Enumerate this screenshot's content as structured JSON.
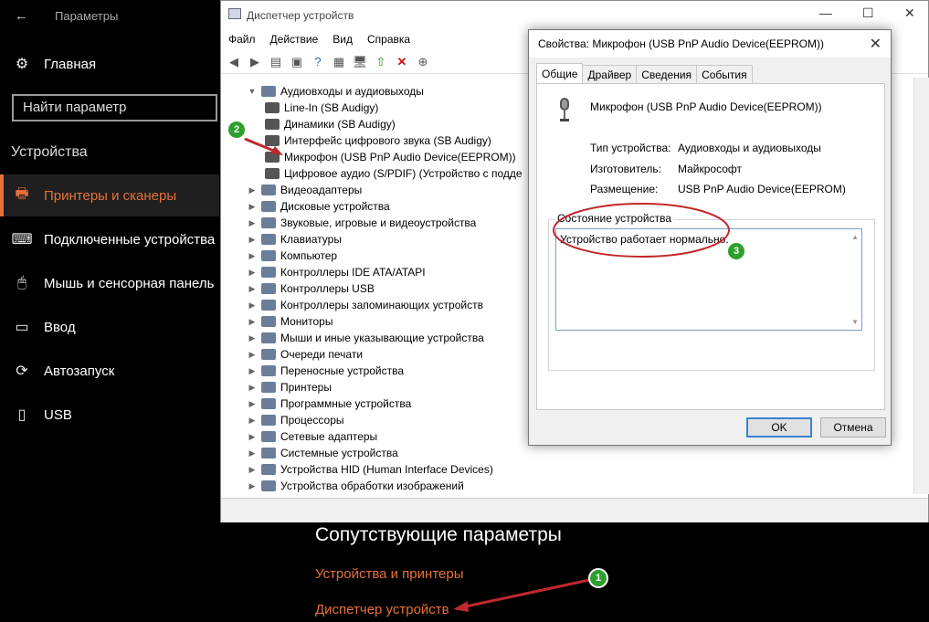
{
  "settings": {
    "title": "Параметры",
    "home": "Главная",
    "search_placeholder": "Найти параметр",
    "section": "Устройства",
    "nav": [
      {
        "label": "Принтеры и сканеры",
        "icon": "printer-icon",
        "glyph": "🖶",
        "active": true
      },
      {
        "label": "Подключенные устройства",
        "icon": "devices-icon",
        "glyph": "⌨"
      },
      {
        "label": "Мышь и сенсорная панель",
        "icon": "mouse-icon",
        "glyph": "🖱"
      },
      {
        "label": "Ввод",
        "icon": "keyboard-icon",
        "glyph": "▭"
      },
      {
        "label": "Автозапуск",
        "icon": "autoplay-icon",
        "glyph": "⟳"
      },
      {
        "label": "USB",
        "icon": "usb-icon",
        "glyph": "▯"
      }
    ],
    "related_title": "Сопутствующие параметры",
    "related_links": [
      "Устройства и принтеры",
      "Диспетчер устройств"
    ],
    "accent": "#e8703a"
  },
  "device_manager": {
    "title": "Диспетчер устройств",
    "menu": [
      "Файл",
      "Действие",
      "Вид",
      "Справка"
    ],
    "tree": [
      {
        "label": "Аудиовходы и аудиовыходы",
        "expanded": true
      },
      {
        "label": "Line-In (SB Audigy)",
        "child": true
      },
      {
        "label": "Динамики (SB Audigy)",
        "child": true
      },
      {
        "label": "Интерфейс цифрового звука (SB Audigy)",
        "child": true
      },
      {
        "label": "Микрофон (USB PnP Audio Device(EEPROM))",
        "child": true
      },
      {
        "label": "Цифровое аудио (S/PDIF) (Устройство с подде",
        "child": true
      },
      {
        "label": "Видеоадаптеры"
      },
      {
        "label": "Дисковые устройства"
      },
      {
        "label": "Звуковые, игровые и видеоустройства"
      },
      {
        "label": "Клавиатуры"
      },
      {
        "label": "Компьютер"
      },
      {
        "label": "Контроллеры IDE ATA/ATAPI"
      },
      {
        "label": "Контроллеры USB"
      },
      {
        "label": "Контроллеры запоминающих устройств"
      },
      {
        "label": "Мониторы"
      },
      {
        "label": "Мыши и иные указывающие устройства"
      },
      {
        "label": "Очереди печати"
      },
      {
        "label": "Переносные устройства"
      },
      {
        "label": "Принтеры"
      },
      {
        "label": "Программные устройства"
      },
      {
        "label": "Процессоры"
      },
      {
        "label": "Сетевые адаптеры"
      },
      {
        "label": "Системные устройства"
      },
      {
        "label": "Устройства HID (Human Interface Devices)"
      },
      {
        "label": "Устройства обработки изображений"
      }
    ]
  },
  "properties": {
    "title": "Свойства: Микрофон (USB PnP Audio Device(EEPROM))",
    "tabs": [
      "Общие",
      "Драйвер",
      "Сведения",
      "События"
    ],
    "device_name": "Микрофон (USB PnP Audio Device(EEPROM))",
    "fields": [
      {
        "label": "Тип устройства:",
        "value": "Аудиовходы и аудиовыходы"
      },
      {
        "label": "Изготовитель:",
        "value": "Майкрософт"
      },
      {
        "label": "Размещение:",
        "value": "USB PnP Audio Device(EEPROM)"
      }
    ],
    "status_group": "Состояние устройства",
    "status_text": "Устройство работает нормально.",
    "ok": "OK",
    "cancel": "Отмена"
  },
  "annotations": {
    "badges": [
      "1",
      "2",
      "3"
    ],
    "color": "#2ca02c",
    "arrow_color": "#c0282d"
  }
}
